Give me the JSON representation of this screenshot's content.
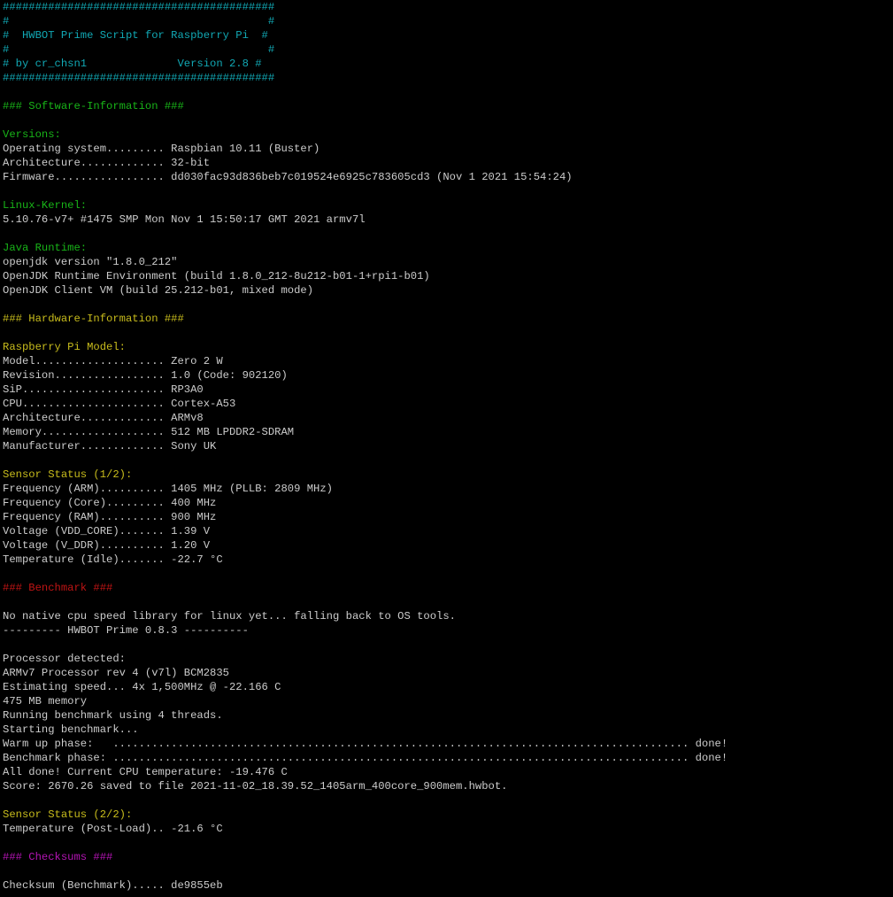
{
  "colors": {
    "background": "#000000",
    "text": "#cccccc",
    "cyan": "#11a8b4",
    "green": "#18b418",
    "yellow": "#c8bc1c",
    "red": "#c01414",
    "magenta": "#b414b4"
  },
  "lines": [
    {
      "text": "##########################################",
      "color": "cyan"
    },
    {
      "text": "#                                        #",
      "color": "cyan"
    },
    {
      "text": "#  HWBOT Prime Script for Raspberry Pi  #",
      "color": "cyan"
    },
    {
      "text": "#                                        #",
      "color": "cyan"
    },
    {
      "text": "# by cr_chsn1              Version 2.8 #",
      "color": "cyan"
    },
    {
      "text": "##########################################",
      "color": "cyan"
    },
    {
      "text": "",
      "color": "white"
    },
    {
      "text": "### Software-Information ###",
      "color": "green"
    },
    {
      "text": "",
      "color": "white"
    },
    {
      "text": "Versions:",
      "color": "green"
    },
    {
      "text": "Operating system......... Raspbian 10.11 (Buster)",
      "color": "white"
    },
    {
      "text": "Architecture............. 32-bit",
      "color": "white"
    },
    {
      "text": "Firmware................. dd030fac93d836beb7c019524e6925c783605cd3 (Nov 1 2021 15:54:24)",
      "color": "white"
    },
    {
      "text": "",
      "color": "white"
    },
    {
      "text": "Linux-Kernel:",
      "color": "green"
    },
    {
      "text": "5.10.76-v7+ #1475 SMP Mon Nov 1 15:50:17 GMT 2021 armv7l",
      "color": "white"
    },
    {
      "text": "",
      "color": "white"
    },
    {
      "text": "Java Runtime:",
      "color": "green"
    },
    {
      "text": "openjdk version \"1.8.0_212\"",
      "color": "white"
    },
    {
      "text": "OpenJDK Runtime Environment (build 1.8.0_212-8u212-b01-1+rpi1-b01)",
      "color": "white"
    },
    {
      "text": "OpenJDK Client VM (build 25.212-b01, mixed mode)",
      "color": "white"
    },
    {
      "text": "",
      "color": "white"
    },
    {
      "text": "### Hardware-Information ###",
      "color": "yellow"
    },
    {
      "text": "",
      "color": "white"
    },
    {
      "text": "Raspberry Pi Model:",
      "color": "yellow"
    },
    {
      "text": "Model.................... Zero 2 W",
      "color": "white"
    },
    {
      "text": "Revision................. 1.0 (Code: 902120)",
      "color": "white"
    },
    {
      "text": "SiP...................... RP3A0",
      "color": "white"
    },
    {
      "text": "CPU...................... Cortex-A53",
      "color": "white"
    },
    {
      "text": "Architecture............. ARMv8",
      "color": "white"
    },
    {
      "text": "Memory................... 512 MB LPDDR2-SDRAM",
      "color": "white"
    },
    {
      "text": "Manufacturer............. Sony UK",
      "color": "white"
    },
    {
      "text": "",
      "color": "white"
    },
    {
      "text": "Sensor Status (1/2):",
      "color": "yellow"
    },
    {
      "text": "Frequency (ARM).......... 1405 MHz (PLLB: 2809 MHz)",
      "color": "white"
    },
    {
      "text": "Frequency (Core)......... 400 MHz",
      "color": "white"
    },
    {
      "text": "Frequency (RAM).......... 900 MHz",
      "color": "white"
    },
    {
      "text": "Voltage (VDD_CORE)....... 1.39 V",
      "color": "white"
    },
    {
      "text": "Voltage (V_DDR).......... 1.20 V",
      "color": "white"
    },
    {
      "text": "Temperature (Idle)....... -22.7 °C",
      "color": "white"
    },
    {
      "text": "",
      "color": "white"
    },
    {
      "text": "### Benchmark ###",
      "color": "red"
    },
    {
      "text": "",
      "color": "white"
    },
    {
      "text": "No native cpu speed library for linux yet... falling back to OS tools.",
      "color": "white"
    },
    {
      "text": "--------- HWBOT Prime 0.8.3 ----------",
      "color": "white"
    },
    {
      "text": "",
      "color": "white"
    },
    {
      "text": "Processor detected:",
      "color": "white"
    },
    {
      "text": "ARMv7 Processor rev 4 (v7l) BCM2835",
      "color": "white"
    },
    {
      "text": "Estimating speed... 4x 1,500MHz @ -22.166 C",
      "color": "white"
    },
    {
      "text": "475 MB memory",
      "color": "white"
    },
    {
      "text": "Running benchmark using 4 threads.",
      "color": "white"
    },
    {
      "text": "Starting benchmark...",
      "color": "white"
    },
    {
      "text": "Warm up phase:   ......................................................................................... done!",
      "color": "white"
    },
    {
      "text": "Benchmark phase: ......................................................................................... done!",
      "color": "white"
    },
    {
      "text": "All done! Current CPU temperature: -19.476 C",
      "color": "white"
    },
    {
      "text": "Score: 2670.26 saved to file 2021-11-02_18.39.52_1405arm_400core_900mem.hwbot.",
      "color": "white"
    },
    {
      "text": "",
      "color": "white"
    },
    {
      "text": "Sensor Status (2/2):",
      "color": "yellow"
    },
    {
      "text": "Temperature (Post-Load).. -21.6 °C",
      "color": "white"
    },
    {
      "text": "",
      "color": "white"
    },
    {
      "text": "### Checksums ###",
      "color": "magenta"
    },
    {
      "text": "",
      "color": "white"
    },
    {
      "text": "Checksum (Benchmark)..... de9855eb",
      "color": "white"
    }
  ]
}
